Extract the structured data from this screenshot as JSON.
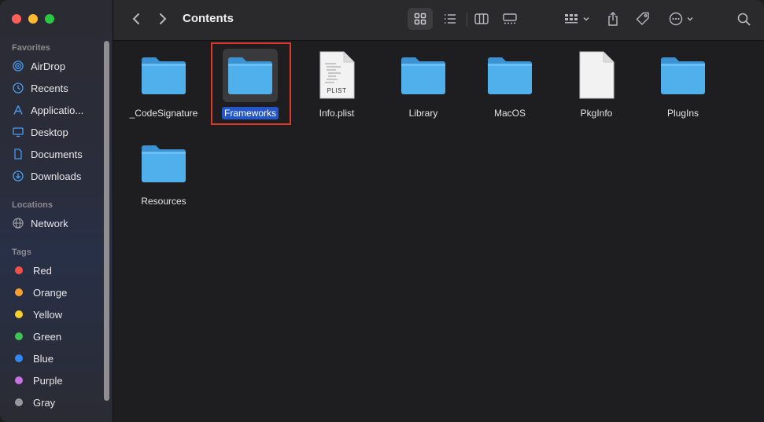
{
  "window": {
    "title": "Contents"
  },
  "sidebar": {
    "favorites_header": "Favorites",
    "favorites": [
      {
        "label": "AirDrop",
        "icon": "airdrop-icon"
      },
      {
        "label": "Recents",
        "icon": "clock-icon"
      },
      {
        "label": "Applicatio...",
        "icon": "applications-icon"
      },
      {
        "label": "Desktop",
        "icon": "desktop-icon"
      },
      {
        "label": "Documents",
        "icon": "document-icon"
      },
      {
        "label": "Downloads",
        "icon": "download-icon"
      }
    ],
    "locations_header": "Locations",
    "locations": [
      {
        "label": "Network",
        "icon": "globe-icon"
      }
    ],
    "tags_header": "Tags",
    "tags": [
      {
        "label": "Red",
        "color": "#f0524a"
      },
      {
        "label": "Orange",
        "color": "#f5a030"
      },
      {
        "label": "Yellow",
        "color": "#f5d02a"
      },
      {
        "label": "Green",
        "color": "#3ec456"
      },
      {
        "label": "Blue",
        "color": "#2f8af5"
      },
      {
        "label": "Purple",
        "color": "#c672e0"
      },
      {
        "label": "Gray",
        "color": "#98989d"
      }
    ]
  },
  "files": [
    {
      "name": "_CodeSignature",
      "type": "folder"
    },
    {
      "name": "Frameworks",
      "type": "folder",
      "selected": true
    },
    {
      "name": "Info.plist",
      "type": "plist",
      "badge": "PLIST"
    },
    {
      "name": "Library",
      "type": "folder"
    },
    {
      "name": "MacOS",
      "type": "folder"
    },
    {
      "name": "PkgInfo",
      "type": "file"
    },
    {
      "name": "PlugIns",
      "type": "folder"
    },
    {
      "name": "Resources",
      "type": "folder"
    }
  ],
  "colors": {
    "accent": "#2456c8",
    "folder": "#4fb0ec",
    "highlight": "#e0392b"
  }
}
